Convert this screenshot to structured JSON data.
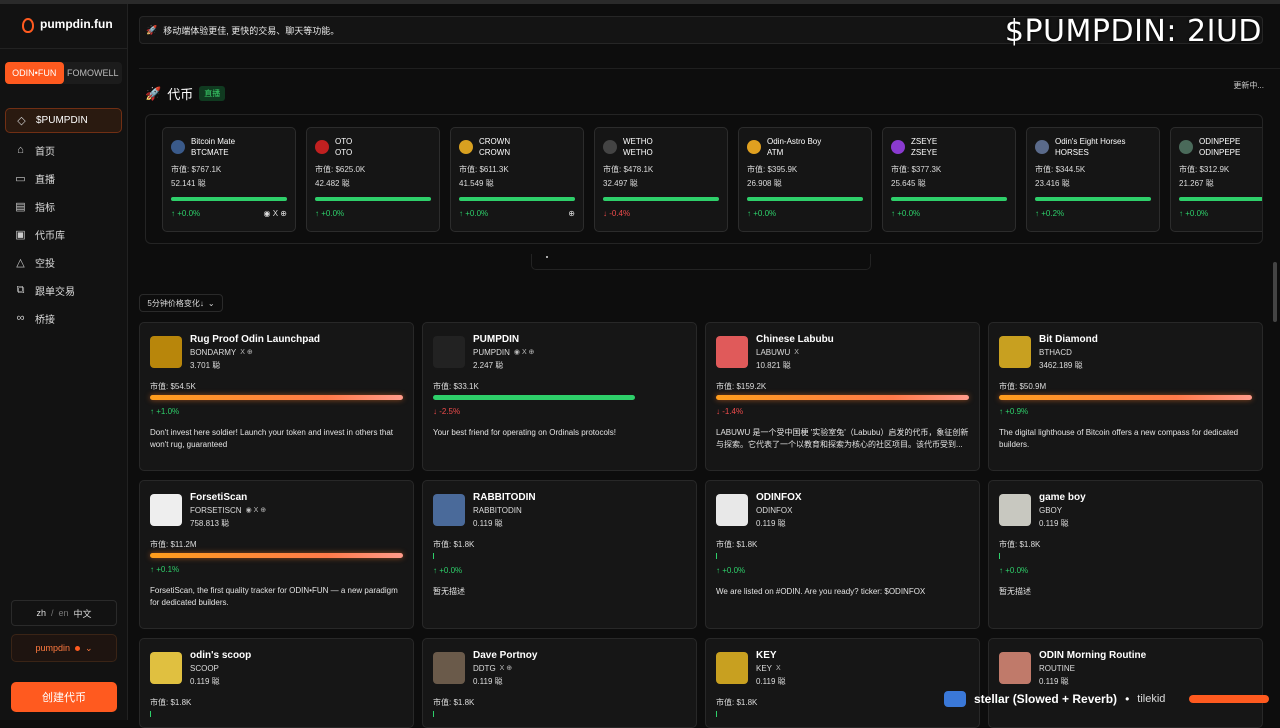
{
  "app": {
    "name": "pumpdin.fun"
  },
  "sidebar": {
    "switch": [
      "ODIN•FUN",
      "FOMOWELL"
    ],
    "items": [
      {
        "label": "$PUMPDIN",
        "icon": "diamond-icon",
        "glyph": "◇"
      },
      {
        "label": "首页",
        "icon": "home-icon",
        "glyph": "⌂"
      },
      {
        "label": "直播",
        "icon": "video-icon",
        "glyph": "▭"
      },
      {
        "label": "指标",
        "icon": "chart-icon",
        "glyph": "▤"
      },
      {
        "label": "代币库",
        "icon": "library-icon",
        "glyph": "▣"
      },
      {
        "label": "空投",
        "icon": "airdrop-icon",
        "glyph": "△"
      },
      {
        "label": "跟单交易",
        "icon": "copy-icon",
        "glyph": "⧉"
      },
      {
        "label": "桥接",
        "icon": "link-icon",
        "glyph": "∞"
      }
    ],
    "lang": {
      "zh": "zh",
      "sep": "/",
      "en": "en",
      "cur": "中文"
    },
    "user": "pumpdin",
    "create": "创建代币"
  },
  "banner": {
    "text": "移动端体验更佳, 更快的交易、聊天等功能。"
  },
  "overlay": {
    "ticker": "$PUMPDIN: 2IUD"
  },
  "section": {
    "title": "代币",
    "badge": "直播",
    "status": "更新中..."
  },
  "strip": [
    {
      "name": "Bitcoin Mate",
      "ticker": "BTCMATE",
      "mcap": "市值: $767.1K",
      "amount": "52.141 聪",
      "change": "↑ +0.0%",
      "dir": "up",
      "color": "#3a5a8a",
      "socials": "◉ X ⊕"
    },
    {
      "name": "OTO",
      "ticker": "OTO",
      "mcap": "市值: $625.0K",
      "amount": "42.482 聪",
      "change": "↑ +0.0%",
      "dir": "up",
      "color": "#c02020",
      "socials": ""
    },
    {
      "name": "CROWN",
      "ticker": "CROWN",
      "mcap": "市值: $611.3K",
      "amount": "41.549 聪",
      "change": "↑ +0.0%",
      "dir": "up",
      "color": "#d8a020",
      "socials": "⊕"
    },
    {
      "name": "WETHO",
      "ticker": "WETHO",
      "mcap": "市值: $478.1K",
      "amount": "32.497 聪",
      "change": "↓ -0.4%",
      "dir": "down",
      "color": "#444444",
      "socials": ""
    },
    {
      "name": "Odin-Astro Boy",
      "ticker": "ATM",
      "mcap": "市值: $395.9K",
      "amount": "26.908 聪",
      "change": "↑ +0.0%",
      "dir": "up",
      "color": "#e0a020",
      "socials": ""
    },
    {
      "name": "ZSEYE",
      "ticker": "ZSEYE",
      "mcap": "市值: $377.3K",
      "amount": "25.645 聪",
      "change": "↑ +0.0%",
      "dir": "up",
      "color": "#8a3ad0",
      "socials": ""
    },
    {
      "name": "Odin's Eight Horses",
      "ticker": "HORSES",
      "mcap": "市值: $344.5K",
      "amount": "23.416 聪",
      "change": "↑ +0.2%",
      "dir": "up",
      "color": "#5a6a8a",
      "socials": ""
    },
    {
      "name": "ODINPEPE",
      "ticker": "ODINPEPE",
      "mcap": "市值: $312.9K",
      "amount": "21.267 聪",
      "change": "↑ +0.0%",
      "dir": "up",
      "color": "#4a6a5a",
      "socials": ""
    }
  ],
  "sort": {
    "label": "5分钟价格变化↓"
  },
  "cards": [
    {
      "name": "Rug Proof Odin Launchpad",
      "ticker": "BONDARMY",
      "soc": "X ⊕",
      "amount": "3.701 聪",
      "mcap": "市值: $54.5K",
      "change": "↑ +1.0%",
      "dir": "up",
      "bar": "grad",
      "fill": 100,
      "desc": "Don't invest here soldier! Launch your token and invest in others that won't rug, guaranteed",
      "color": "#b8860b"
    },
    {
      "name": "PUMPDIN",
      "ticker": "PUMPDIN",
      "soc": "◉ X ⊕",
      "amount": "2.247 聪",
      "mcap": "市值: $33.1K",
      "change": "↓ -2.5%",
      "dir": "down",
      "bar": "green",
      "fill": 80,
      "desc": "Your best friend for operating on Ordinals protocols!",
      "color": "#222222"
    },
    {
      "name": "Chinese Labubu",
      "ticker": "LABUWU",
      "soc": "X",
      "amount": "10.821 聪",
      "mcap": "市值: $159.2K",
      "change": "↓ -1.4%",
      "dir": "down",
      "bar": "grad",
      "fill": 100,
      "desc": "LABUWU 是一个受中国梗 '实验室兔'（Labubu）启发的代币，象征创新与探索。它代表了一个以教育和探索为核心的社区项目。该代币受到...",
      "color": "#e05a5a"
    },
    {
      "name": "Bit Diamond",
      "ticker": "BTHACD",
      "soc": "",
      "amount": "3462.189 聪",
      "mcap": "市值: $50.9M",
      "change": "↑ +0.9%",
      "dir": "up",
      "bar": "grad",
      "fill": 100,
      "desc": "The digital lighthouse of Bitcoin offers a new compass for dedicated builders.",
      "color": "#c8a020"
    },
    {
      "name": "ForsetiScan",
      "ticker": "FORSETISCN",
      "soc": "◉ X ⊕",
      "amount": "758.813 聪",
      "mcap": "市值: $11.2M",
      "change": "↑ +0.1%",
      "dir": "up",
      "bar": "grad",
      "fill": 100,
      "desc": "ForsetiScan, the first quality tracker for ODIN•FUN — a new paradigm for dedicated builders.",
      "color": "#eeeeee"
    },
    {
      "name": "RABBITODIN",
      "ticker": "RABBITODIN",
      "soc": "",
      "amount": "0.119 聪",
      "mcap": "市值: $1.8K",
      "change": "↑ +0.0%",
      "dir": "up",
      "bar": "thin",
      "fill": 0,
      "desc": "暂无描述",
      "color": "#4a6a9a"
    },
    {
      "name": "ODINFOX",
      "ticker": "ODINFOX",
      "soc": "",
      "amount": "0.119 聪",
      "mcap": "市值: $1.8K",
      "change": "↑ +0.0%",
      "dir": "up",
      "bar": "thin",
      "fill": 0,
      "desc": "We are listed on #ODIN. Are you ready? ticker: $ODINFOX",
      "color": "#e8e8e8"
    },
    {
      "name": "game boy",
      "ticker": "GBOY",
      "soc": "",
      "amount": "0.119 聪",
      "mcap": "市值: $1.8K",
      "change": "↑ +0.0%",
      "dir": "up",
      "bar": "thin",
      "fill": 0,
      "desc": "暂无描述",
      "color": "#c8c8c0"
    },
    {
      "name": "odin's scoop",
      "ticker": "SCOOP",
      "soc": "",
      "amount": "0.119 聪",
      "mcap": "市值: $1.8K",
      "change": "",
      "dir": "up",
      "bar": "thin",
      "fill": 0,
      "desc": "",
      "color": "#e0c040"
    },
    {
      "name": "Dave Portnoy",
      "ticker": "DDTG",
      "soc": "X ⊕",
      "amount": "0.119 聪",
      "mcap": "市值: $1.8K",
      "change": "",
      "dir": "up",
      "bar": "thin",
      "fill": 0,
      "desc": "",
      "color": "#6a5a4a"
    },
    {
      "name": "KEY",
      "ticker": "KEY",
      "soc": "X",
      "amount": "0.119 聪",
      "mcap": "市值: $1.8K",
      "change": "",
      "dir": "up",
      "bar": "thin",
      "fill": 0,
      "desc": "",
      "color": "#c8a020"
    },
    {
      "name": "ODIN Morning Routine",
      "ticker": "ROUTINE",
      "soc": "",
      "amount": "0.119 聪",
      "mcap": "",
      "change": "",
      "dir": "up",
      "bar": "thin",
      "fill": 0,
      "desc": "",
      "color": "#c07a6a"
    }
  ],
  "toast": {
    "title": "stellar (Slowed + Reverb)",
    "sep": "•",
    "artist": "tilekid"
  }
}
